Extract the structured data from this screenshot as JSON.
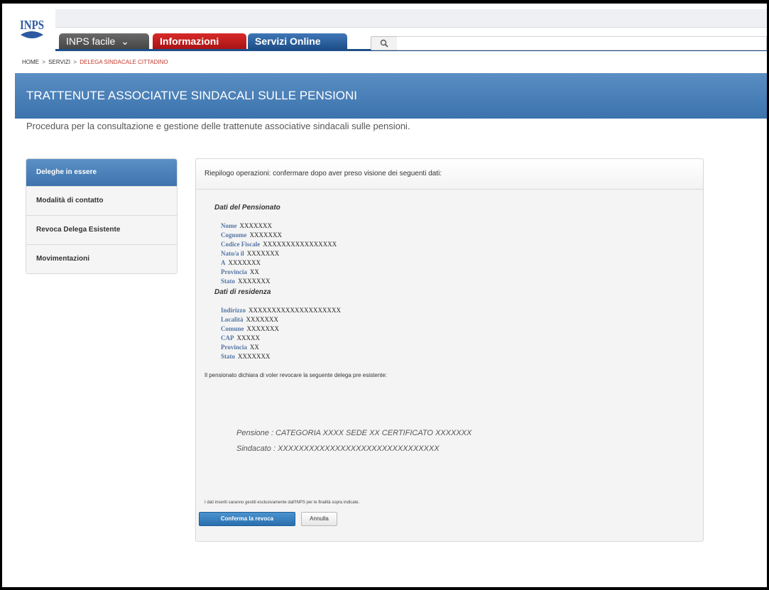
{
  "header": {
    "logo_text": "INPS",
    "tabs": [
      {
        "label": "INPS facile",
        "arrow": "⌄"
      },
      {
        "label": "Informazioni"
      },
      {
        "label": "Servizi Online"
      }
    ],
    "search_icon": "magnifier-icon"
  },
  "breadcrumb": {
    "items": [
      "HOME",
      "SERVIZI",
      "DELEGA SINDACALE CITTADINO"
    ],
    "separator": ">"
  },
  "banner": {
    "title": "TRATTENUTE ASSOCIATIVE SINDACALI SULLE PENSIONI",
    "subtitle": "Procedura per la consultazione e gestione delle trattenute associative sindacali sulle pensioni."
  },
  "sidebar": {
    "items": [
      {
        "label": "Deleghe in essere"
      },
      {
        "label": "Modalità di contatto"
      },
      {
        "label": "Revoca Delega Esistente"
      },
      {
        "label": "Movimentazioni"
      }
    ]
  },
  "panel": {
    "header": "Riepilogo operazioni: confermare dopo aver preso visione dei seguenti dati:",
    "pensionato_title": "Dati del Pensionato",
    "pensionato": [
      {
        "label": "Nome",
        "value": "XXXXXXX"
      },
      {
        "label": "Cognome",
        "value": "XXXXXXX"
      },
      {
        "label": "Codice Fiscale",
        "value": "XXXXXXXXXXXXXXXX"
      },
      {
        "label": "Nato/a il",
        "value": "XXXXXXX"
      },
      {
        "label": "A",
        "value": "XXXXXXX"
      },
      {
        "label": "Provincia",
        "value": "XX"
      },
      {
        "label": "Stato",
        "value": "XXXXXXX"
      }
    ],
    "residenza_title": "Dati di residenza",
    "residenza": [
      {
        "label": "Indirizzo",
        "value": "XXXXXXXXXXXXXXXXXXXX"
      },
      {
        "label": "Località",
        "value": "XXXXXXX"
      },
      {
        "label": "Comune",
        "value": "XXXXXXX"
      },
      {
        "label": "CAP",
        "value": "XXXXX"
      },
      {
        "label": "Provincia",
        "value": "XX"
      },
      {
        "label": "Stato",
        "value": "XXXXXXX"
      }
    ],
    "declaration": "Il pensionato dichiara di voler revocare la seguente delega pre esistente:",
    "pensione_line": "Pensione : CATEGORIA XXXX   SEDE XX CERTIFICATO XXXXXXX",
    "sindacato_line": "Sindacato : XXXXXXXXXXXXXXXXXXXXXXXXXXXXXXX",
    "privacy_note": "I dati inseriti saranno gestiti esclusivamente dall'INPS per le finalità sopra indicate.",
    "confirm_label": "Conferma la revoca",
    "cancel_label": "Annulla"
  }
}
